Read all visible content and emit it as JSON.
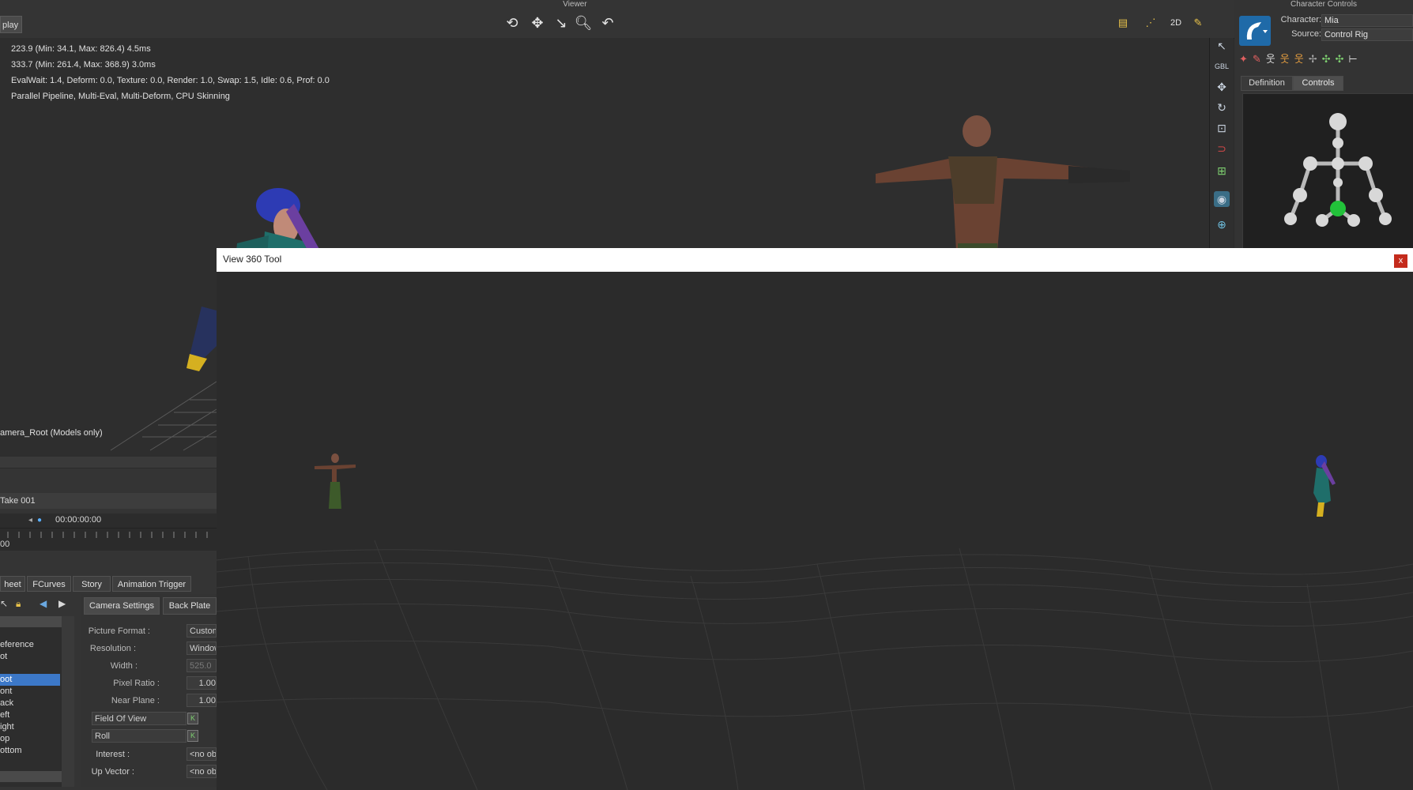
{
  "topbar": {
    "viewer_title": "Viewer",
    "play_tab": "play"
  },
  "stats": {
    "line1": "223.9   (Min: 34.1, Max: 826.4)   4.5ms",
    "line2": "333.7   (Min: 261.4, Max: 368.9)   3.0ms",
    "line3": "EvalWait: 1.4, Deform: 0.0, Texture: 0.0, Render: 1.0, Swap: 1.5, Idle: 0.6, Prof: 0.0",
    "line4": "Parallel Pipeline, Multi-Eval, Multi-Deform, CPU Skinning"
  },
  "viewer": {
    "camera_label": "amera_Root (Models only)"
  },
  "toolstrip": {
    "gbl": "GBL"
  },
  "character_controls": {
    "title": "Character Controls",
    "character_label": "Character:",
    "character_value": "Mia",
    "source_label": "Source:",
    "source_value": "Control Rig",
    "tab_definition": "Definition",
    "tab_controls": "Controls",
    "colors": {
      "accent": "#1f6aa8",
      "effector": "#22c23a"
    }
  },
  "timeline": {
    "take": "Take 001",
    "timecode": "00:00:00:00",
    "ruler_start": "00"
  },
  "bottom_tabs": [
    "heet",
    "FCurves",
    "Story",
    "Animation Trigger"
  ],
  "list": [
    "eference",
    "ot",
    "oot",
    "ont",
    "ack",
    "eft",
    "ight",
    "op",
    "ottom"
  ],
  "props": {
    "tab_camera_settings": "Camera Settings",
    "tab_back_plate": "Back Plate",
    "picture_format_label": "Picture Format :",
    "picture_format_value": "Custom",
    "resolution_label": "Resolution :",
    "resolution_value": "Window",
    "width_label": "Width :",
    "width_value": "525.0",
    "pixel_ratio_label": "Pixel Ratio :",
    "pixel_ratio_value": "1.00",
    "near_plane_label": "Near Plane :",
    "near_plane_value": "1.00",
    "fov_label": "Field Of View",
    "roll_label": "Roll",
    "interest_label": "Interest :",
    "interest_value": "<no ob",
    "up_vector_label": "Up Vector :",
    "up_vector_value": "<no ob"
  },
  "dialog": {
    "title": "View 360 Tool",
    "close": "x"
  }
}
